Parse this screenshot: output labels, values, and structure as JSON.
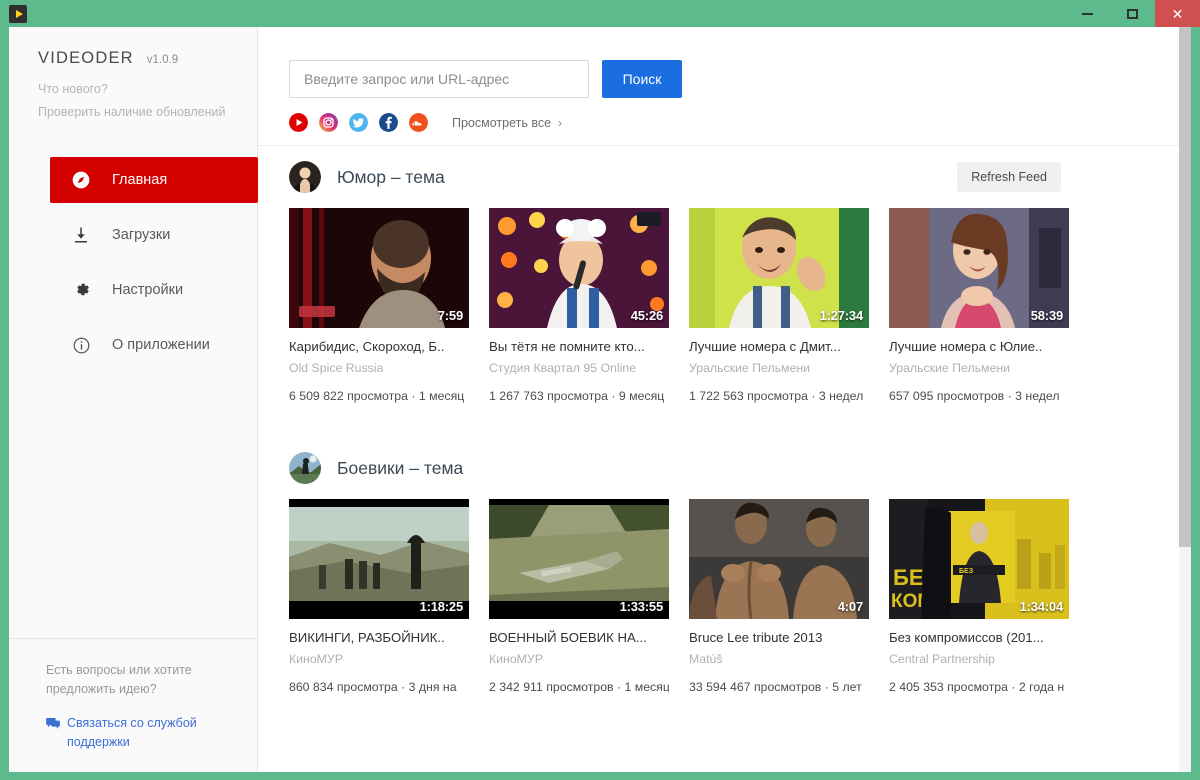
{
  "window": {
    "logo_icon": "videoder-play-logo",
    "minimize_label": "–",
    "maximize_label": "□",
    "close_label": "×",
    "frame_color": "#5cba8d",
    "close_color": "#d05050"
  },
  "sidebar": {
    "brand_name": "VIDEODER",
    "version": "v1.0.9",
    "whats_new": "Что нового?",
    "check_updates": "Проверить наличие обновлений",
    "active_color": "#d30000",
    "items": [
      {
        "label": "Главная",
        "icon": "compass-icon",
        "active": true
      },
      {
        "label": "Загрузки",
        "icon": "download-icon",
        "active": false
      },
      {
        "label": "Настройки",
        "icon": "gear-icon",
        "active": false
      },
      {
        "label": "О приложении",
        "icon": "info-icon",
        "active": false
      }
    ],
    "support": {
      "question": "Есть вопросы или хотите предложить идею?",
      "link": "Связаться со службой поддержки",
      "link_icon": "chat-icon",
      "link_color": "#3b6fd4"
    }
  },
  "search": {
    "placeholder": "Введите запрос или URL-адрес",
    "value": "",
    "button_label": "Поиск",
    "button_color": "#1a6ee0",
    "view_all_label": "Просмотреть все",
    "view_all_chevron": "›",
    "socials": [
      {
        "name": "youtube-icon",
        "color": "#e00000"
      },
      {
        "name": "instagram-icon",
        "color": "#c13584"
      },
      {
        "name": "twitter-icon",
        "color": "#4db5ee"
      },
      {
        "name": "facebook-icon",
        "color": "#1b4a8f"
      },
      {
        "name": "soundcloud-icon",
        "color": "#f1501e"
      }
    ]
  },
  "sections": [
    {
      "title": "Юмор – тема",
      "avatar": "humor-topic-avatar",
      "refresh_label": "Refresh Feed",
      "next_arrow": "›",
      "cards": [
        {
          "title": "Карибидис, Скороход, Б..",
          "channel": "Old Spice Russia",
          "meta": "6 509 822 просмотра · 1 месяц",
          "duration": "7:59"
        },
        {
          "title": "Вы тётя не помните кто...",
          "channel": "Студия Квартал 95 Online",
          "meta": "1 267 763 просмотра · 9 месяц",
          "duration": "45:26"
        },
        {
          "title": "Лучшие номера с Дмит...",
          "channel": "Уральские Пельмени",
          "meta": "1 722 563 просмотра · 3 недел",
          "duration": "1:27:34"
        },
        {
          "title": "Лучшие номера с Юлие..",
          "channel": "Уральские Пельмени",
          "meta": "657 095 просмотров · 3 недел",
          "duration": "58:39"
        }
      ]
    },
    {
      "title": "Боевики – тема",
      "avatar": "action-topic-avatar",
      "refresh_label": "",
      "next_arrow": "›",
      "cards": [
        {
          "title": "ВИКИНГИ, РАЗБОЙНИК..",
          "channel": "КиноМУР",
          "meta": "860 834 просмотра · 3 дня на",
          "duration": "1:18:25"
        },
        {
          "title": "ВОЕННЫЙ БОЕВИК НА...",
          "channel": "КиноМУР",
          "meta": "2 342 911 просмотров · 1 месяц",
          "duration": "1:33:55"
        },
        {
          "title": "Bruce Lee tribute 2013",
          "channel": "Matúš",
          "meta": "33 594 467 просмотров · 5 лет",
          "duration": "4:07"
        },
        {
          "title": "Без компромиссов (201...",
          "channel": "Central Partnership",
          "meta": "2 405 353 просмотра · 2 года н",
          "duration": "1:34:04"
        }
      ]
    }
  ]
}
